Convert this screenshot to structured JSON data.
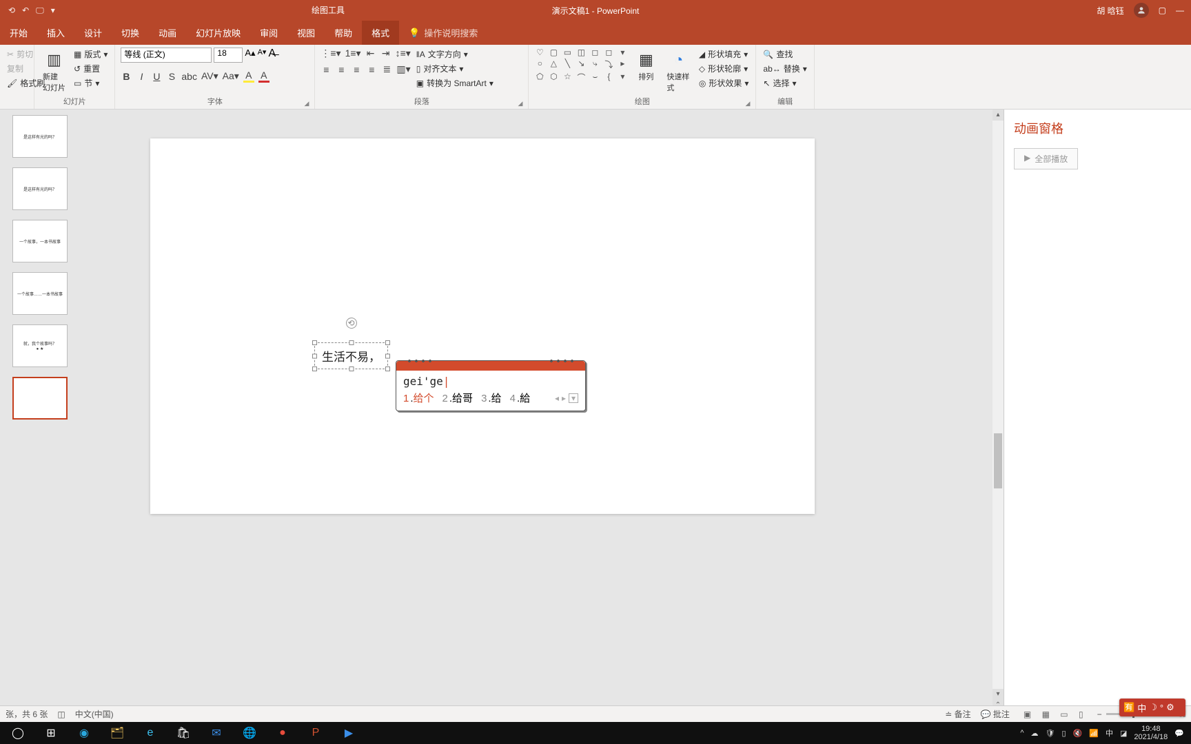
{
  "titlebar": {
    "tool_tab": "绘图工具",
    "doc_title": "演示文稿1 - PowerPoint",
    "user_name": "胡 晗钰"
  },
  "tabs": {
    "home": "开始",
    "insert": "插入",
    "design": "设计",
    "transition": "切换",
    "animation": "动画",
    "slideshow": "幻灯片放映",
    "review": "审阅",
    "view": "视图",
    "help": "帮助",
    "format": "格式",
    "search_hint": "操作说明搜索"
  },
  "ribbon": {
    "clipboard": {
      "cut": "剪切",
      "copy": "复制",
      "painter": "格式刷"
    },
    "slides": {
      "new_slide": "新建\n幻灯片",
      "layout": "版式",
      "reset": "重置",
      "section": "节",
      "label": "幻灯片"
    },
    "font": {
      "family": "等线 (正文)",
      "size": "18",
      "label": "字体"
    },
    "para": {
      "dir": "文字方向",
      "align": "对齐文本",
      "smartart": "转换为 SmartArt",
      "label": "段落"
    },
    "drawing": {
      "arrange": "排列",
      "quick": "快速样式",
      "fill": "形状填充",
      "outline": "形状轮廓",
      "effects": "形状效果",
      "label": "绘图"
    },
    "editing": {
      "find": "查找",
      "replace": "替换",
      "select": "选择",
      "label": "编辑"
    }
  },
  "slide_text": "生活不易，",
  "ime": {
    "input": "gei'ge",
    "candidates": [
      {
        "n": "1",
        "t": "给个"
      },
      {
        "n": "2",
        "t": "给哥"
      },
      {
        "n": "3",
        "t": "给"
      },
      {
        "n": "4",
        "t": "給"
      }
    ]
  },
  "anim_pane": {
    "title": "动画窗格",
    "play_all": "全部播放"
  },
  "status": {
    "slide_info": "张，共 6 张",
    "lang": "中文(中国)",
    "notes": "备注",
    "comments": "批注"
  },
  "taskbar": {
    "time": "19:48",
    "date": "2021/4/18"
  },
  "ime_float": {
    "text": "中"
  }
}
